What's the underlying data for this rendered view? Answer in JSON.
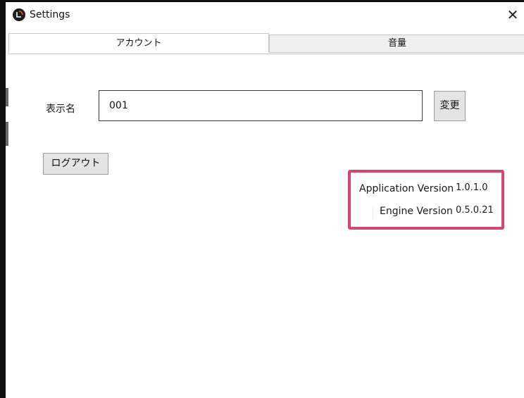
{
  "window": {
    "title": "Settings",
    "close_glyph": "✕",
    "app_icon": "app-logo-icon"
  },
  "tabs": [
    {
      "label": "アカウント",
      "active": true
    },
    {
      "label": "音量",
      "active": false
    }
  ],
  "account": {
    "display_name_label": "表示名",
    "display_name_value": "001",
    "change_button_label": "変更",
    "logout_button_label": "ログアウト"
  },
  "versions": {
    "application_label": "Application Version",
    "application_value": "1.0.1.0",
    "engine_label": "Engine Version",
    "engine_value": "0.5.0.21",
    "highlight_color": "#d6476d"
  }
}
